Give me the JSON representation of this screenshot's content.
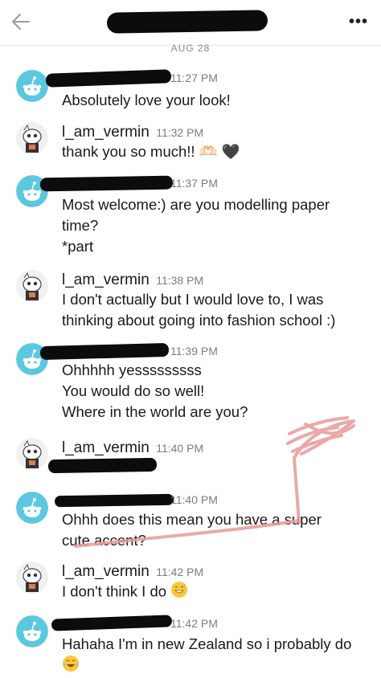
{
  "header": {
    "title": "",
    "more_icon": "•••",
    "back_icon": "arrow-left-icon"
  },
  "date_label": "AUG 28",
  "messages": [
    {
      "user": "other",
      "name": "",
      "time": "11:27 PM",
      "lines": [
        "Absolutely love your look!"
      ]
    },
    {
      "user": "self",
      "name": "l_am_vermin",
      "time": "11:32 PM",
      "lines": [
        "thank you so much!! 🫶🏻 🖤"
      ]
    },
    {
      "user": "other",
      "name": "",
      "time": "11:37 PM",
      "lines": [
        "Most welcome:) are you modelling paper",
        "time?",
        "*part"
      ]
    },
    {
      "user": "self",
      "name": "l_am_vermin",
      "time": "11:38 PM",
      "lines": [
        "I don't actually but I would love to, I was",
        "thinking about going into fashion school :)"
      ]
    },
    {
      "user": "other",
      "name": "",
      "time": "11:39 PM",
      "lines": [
        "Ohhhhh yesssssssss",
        "You would do so well!",
        "Where in the world are you?"
      ]
    },
    {
      "user": "self",
      "name": "l_am_vermin",
      "time": "11:40 PM",
      "lines": [
        ""
      ]
    },
    {
      "user": "other",
      "name": "",
      "time": "11:40 PM",
      "lines": [
        "Ohhh does this mean you have a super",
        "cute accent?"
      ]
    },
    {
      "user": "self",
      "name": "l_am_vermin",
      "time": "11:42 PM",
      "lines": [
        "I don't think I do"
      ]
    },
    {
      "user": "other",
      "name": "",
      "time": "11:42 PM",
      "lines": [
        "Hahaha I'm in new Zealand so i probably do"
      ]
    }
  ],
  "colors": {
    "text": "#1a1a1b",
    "meta": "#7c7c7c",
    "avatar_bg": "#5bc8e0",
    "redaction": "#0c0c0c",
    "scribble": "#e89a9a"
  }
}
